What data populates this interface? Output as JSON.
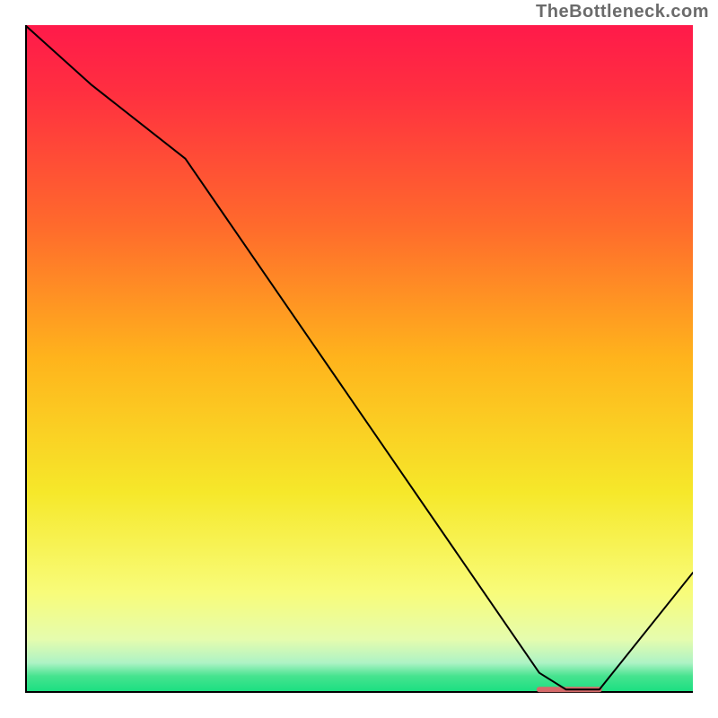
{
  "branding": {
    "watermark": "TheBottleneck.com"
  },
  "chart_data": {
    "type": "line",
    "title": "",
    "xlabel": "",
    "ylabel": "",
    "xlim": [
      0,
      100
    ],
    "ylim": [
      0,
      100
    ],
    "grid": false,
    "series": [
      {
        "name": "curve",
        "x": [
          0,
          10,
          24,
          77,
          81,
          86,
          100
        ],
        "y": [
          100,
          91,
          80,
          3,
          0.5,
          0.5,
          18
        ],
        "stroke": "#000000",
        "stroke_width": 2
      }
    ],
    "highlight_segment": {
      "x_start": 77,
      "x_end": 86,
      "y": 0.5,
      "color": "#d66a6a",
      "thickness": 6
    },
    "background_gradient": {
      "stops": [
        {
          "offset": 0.0,
          "color": "#ff1a4a"
        },
        {
          "offset": 0.1,
          "color": "#ff2f40"
        },
        {
          "offset": 0.3,
          "color": "#ff6a2c"
        },
        {
          "offset": 0.5,
          "color": "#ffb41c"
        },
        {
          "offset": 0.7,
          "color": "#f6e82a"
        },
        {
          "offset": 0.85,
          "color": "#f8fc7a"
        },
        {
          "offset": 0.92,
          "color": "#e5fcae"
        },
        {
          "offset": 0.955,
          "color": "#aef3c5"
        },
        {
          "offset": 0.975,
          "color": "#46e38f"
        },
        {
          "offset": 1.0,
          "color": "#17df80"
        }
      ]
    },
    "axes": {
      "color": "#000000",
      "width": 4
    }
  }
}
